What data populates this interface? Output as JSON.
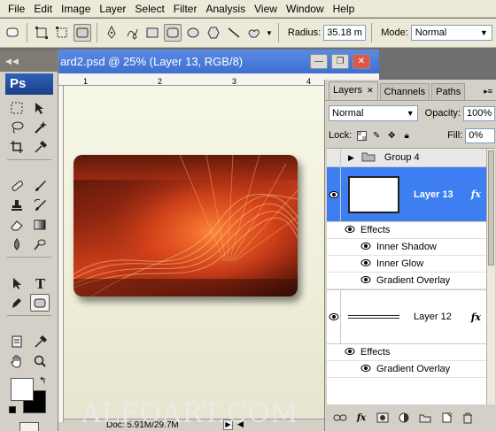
{
  "menu": [
    "File",
    "Edit",
    "Image",
    "Layer",
    "Select",
    "Filter",
    "Analysis",
    "View",
    "Window",
    "Help"
  ],
  "options": {
    "radius_label": "Radius:",
    "radius_value": "35.18 m",
    "mode_label": "Mode:",
    "mode_value": "Normal"
  },
  "tools": {
    "logo": "Ps"
  },
  "document": {
    "title": "ard2.psd @ 25% (Layer 13, RGB/8)",
    "ruler_ticks": [
      "1",
      "2",
      "3",
      "4"
    ],
    "status": "Doc: 5.91M/29.7M"
  },
  "layers_panel": {
    "tabs": [
      "Layers",
      "Channels",
      "Paths"
    ],
    "blend_mode": "Normal",
    "opacity_label": "Opacity:",
    "opacity_value": "100%",
    "lock_label": "Lock:",
    "fill_label": "Fill:",
    "fill_value": "0%",
    "group_name": "Group 4",
    "layer13": {
      "name": "Layer 13",
      "effects_label": "Effects",
      "effects": [
        "Inner Shadow",
        "Inner Glow",
        "Gradient Overlay"
      ]
    },
    "layer12": {
      "name": "Layer 12",
      "effects_label": "Effects",
      "effects": [
        "Gradient Overlay"
      ]
    },
    "fx_label": "fx"
  },
  "watermark": "ALFOART.COM",
  "colors": {
    "selection": "#3d7ef0",
    "title_bar": "#3f6fd0",
    "card_orange": "#d0401a"
  }
}
